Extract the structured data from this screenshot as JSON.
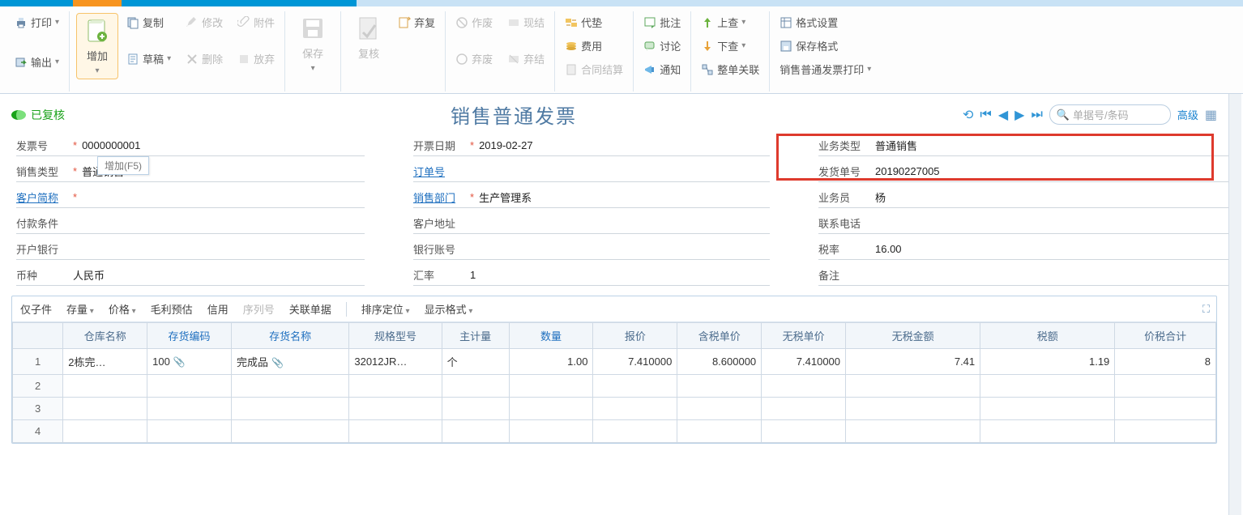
{
  "ribbon": {
    "print": "打印",
    "export": "输出",
    "add": "增加",
    "copy": "复制",
    "modify": "修改",
    "attach": "附件",
    "draft": "草稿",
    "delete": "删除",
    "save": "保存",
    "giveup": "放弃",
    "review": "复核",
    "unreview": "弃复",
    "void": "作废",
    "unvoid": "弃废",
    "cash": "现结",
    "abandon_cash": "弃结",
    "advance_pay": "代垫",
    "expense": "费用",
    "contract_settle": "合同结算",
    "annotate": "批注",
    "discuss": "讨论",
    "notify": "通知",
    "up_query": "上查",
    "down_query": "下查",
    "whole_link": "整单关联",
    "format": "格式设置",
    "save_format": "保存格式",
    "print_template": "销售普通发票打印"
  },
  "tooltip_add": "增加(F5)",
  "status": "已复核",
  "title": "销售普通发票",
  "search_placeholder": "单据号/条码",
  "advanced": "高级",
  "form": {
    "invoice_no_lbl": "发票号",
    "invoice_no": "0000000001",
    "sale_type_lbl": "销售类型",
    "sale_type": "普通销售",
    "cust_abbr_lbl": "客户简称",
    "cust_abbr": "",
    "pay_term_lbl": "付款条件",
    "bank_lbl": "开户银行",
    "currency_lbl": "币种",
    "currency": "人民币",
    "date_lbl": "开票日期",
    "date": "2019-02-27",
    "order_no_lbl": "订单号",
    "sale_dept_lbl": "销售部门",
    "sale_dept": "生产管理系",
    "cust_addr_lbl": "客户地址",
    "bank_acct_lbl": "银行账号",
    "exch_lbl": "汇率",
    "exch": "1",
    "biz_type_lbl": "业务类型",
    "biz_type": "普通销售",
    "ship_no_lbl": "发货单号",
    "ship_no": "20190227005",
    "sales_lbl": "业务员",
    "sales": "杨",
    "phone_lbl": "联系电话",
    "tax_lbl": "税率",
    "tax": "16.00",
    "remark_lbl": "备注"
  },
  "grid_toolbar": {
    "only_sub": "仅子件",
    "stock": "存量",
    "price": "价格",
    "profit": "毛利预估",
    "credit": "信用",
    "serial": "序列号",
    "linked": "关联单据",
    "sort": "排序定位",
    "disp": "显示格式"
  },
  "columns": {
    "rownum": "",
    "wh": "仓库名称",
    "inv_code": "存货编码",
    "inv_name": "存货名称",
    "spec": "规格型号",
    "uom": "主计量",
    "qty": "数量",
    "quote": "报价",
    "tax_price": "含税单价",
    "notax_price": "无税单价",
    "notax_amt": "无税金额",
    "tax_amt": "税额",
    "total": "价税合计"
  },
  "rows": [
    {
      "rownum": "1",
      "wh": "2栋完…",
      "inv_code": "100",
      "inv_name": "完成品",
      "spec": "32012JR…",
      "uom": "个",
      "qty": "1.00",
      "quote": "7.410000",
      "tax_price": "8.600000",
      "notax_price": "7.410000",
      "notax_amt": "7.41",
      "tax_amt": "1.19",
      "total": "8"
    },
    {
      "rownum": "2"
    },
    {
      "rownum": "3"
    },
    {
      "rownum": "4"
    }
  ]
}
